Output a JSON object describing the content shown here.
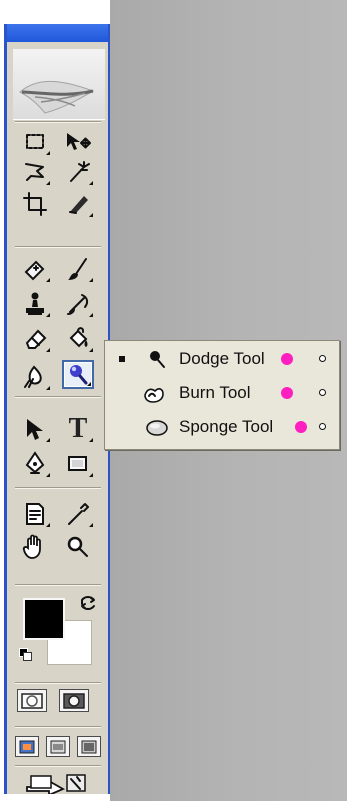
{
  "workspace": {
    "background_color": "#b2b2b2"
  },
  "toolbox": {
    "frame_color": "#2b54c8",
    "header_icon": "feather-logo-icon",
    "tools": [
      {
        "name": "marquee-tool-icon"
      },
      {
        "name": "move-tool-icon"
      },
      {
        "name": "lasso-tool-icon"
      },
      {
        "name": "magic-wand-tool-icon"
      },
      {
        "name": "crop-tool-icon"
      },
      {
        "name": "slice-tool-icon"
      },
      {
        "name": "healing-brush-tool-icon"
      },
      {
        "name": "brush-tool-icon"
      },
      {
        "name": "clone-stamp-tool-icon"
      },
      {
        "name": "history-brush-tool-icon"
      },
      {
        "name": "eraser-tool-icon"
      },
      {
        "name": "paint-bucket-tool-icon"
      },
      {
        "name": "blur-tool-icon"
      },
      {
        "name": "dodge-tool-icon"
      },
      {
        "name": "path-selection-tool-icon"
      },
      {
        "name": "type-tool-icon"
      },
      {
        "name": "pen-tool-icon"
      },
      {
        "name": "shape-tool-icon"
      },
      {
        "name": "notes-tool-icon"
      },
      {
        "name": "eyedropper-tool-icon"
      },
      {
        "name": "hand-tool-icon"
      },
      {
        "name": "zoom-tool-icon"
      }
    ],
    "colors": {
      "foreground": "#000000",
      "background": "#ffffff"
    }
  },
  "flyout": {
    "items": [
      {
        "label": "Dodge Tool"
      },
      {
        "label": "Burn Tool"
      },
      {
        "label": "Sponge Tool"
      }
    ],
    "dot_color": "#ff1fc0"
  }
}
